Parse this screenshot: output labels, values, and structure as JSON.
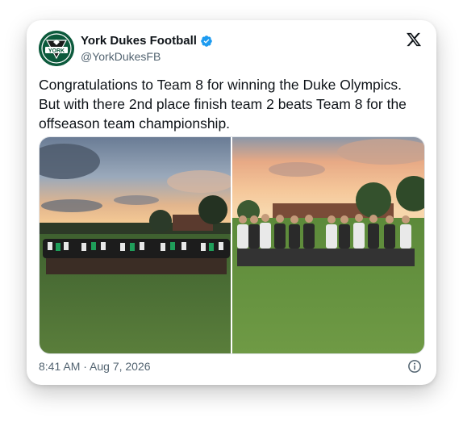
{
  "post": {
    "author": {
      "display_name": "York Dukes Football",
      "handle": "@YorkDukesFB",
      "verified": true,
      "avatar_icon": "york-dukes-logo",
      "avatar_text": "YORK"
    },
    "platform_icon": "x-logo-icon",
    "text": "Congratulations to Team 8 for winning the Duke Olympics. But with there 2nd place finish team 2 beats Team 8 for the offseason team championship.",
    "media": [
      {
        "icon": "team-photo-1"
      },
      {
        "icon": "team-photo-2"
      }
    ],
    "timestamp": "8:41 AM · Aug 7, 2026",
    "info_icon": "info-icon"
  },
  "colors": {
    "brand_green": "#0c5a3c",
    "verified_blue": "#1d9bf0",
    "secondary_text": "#536471",
    "primary_text": "#0f1419"
  }
}
